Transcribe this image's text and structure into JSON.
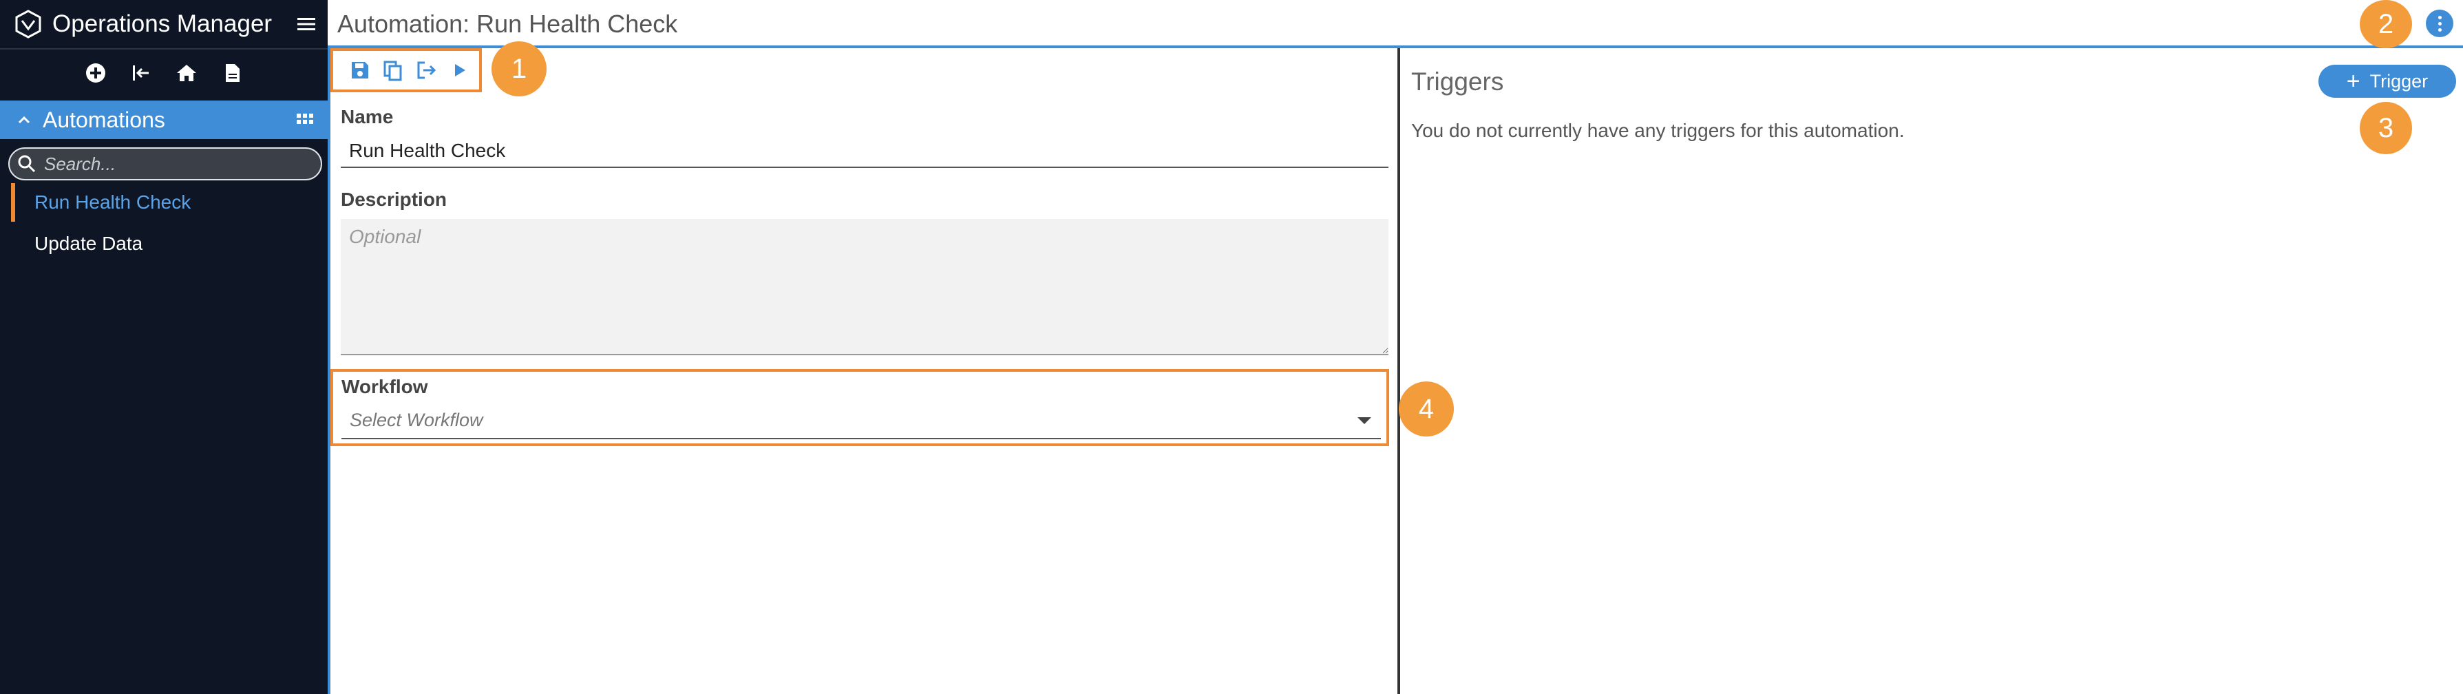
{
  "app": {
    "name": "Operations Manager"
  },
  "sidebar": {
    "section_title": "Automations",
    "search_placeholder": "Search...",
    "items": [
      {
        "label": "Run Health Check",
        "active": true
      },
      {
        "label": "Update Data",
        "active": false
      }
    ],
    "quick_icons": [
      "add-circle-icon",
      "exit-icon",
      "home-icon",
      "document-icon"
    ]
  },
  "header": {
    "title": "Automation: Run Health Check"
  },
  "toolbar": {
    "icons": [
      "save-icon",
      "copy-icon",
      "export-icon",
      "run-icon"
    ]
  },
  "form": {
    "name_label": "Name",
    "name_value": "Run Health Check",
    "description_label": "Description",
    "description_placeholder": "Optional",
    "workflow_label": "Workflow",
    "workflow_placeholder": "Select Workflow"
  },
  "triggers": {
    "title": "Triggers",
    "empty_message": "You do not currently have any triggers for this automation.",
    "add_button_label": "Trigger"
  },
  "callouts": [
    "1",
    "2",
    "3",
    "4"
  ],
  "colors": {
    "accent": "#3e8dd6",
    "highlight": "#ee8a35",
    "callout": "#f39c3b",
    "sidebar_bg": "#0e1625"
  }
}
